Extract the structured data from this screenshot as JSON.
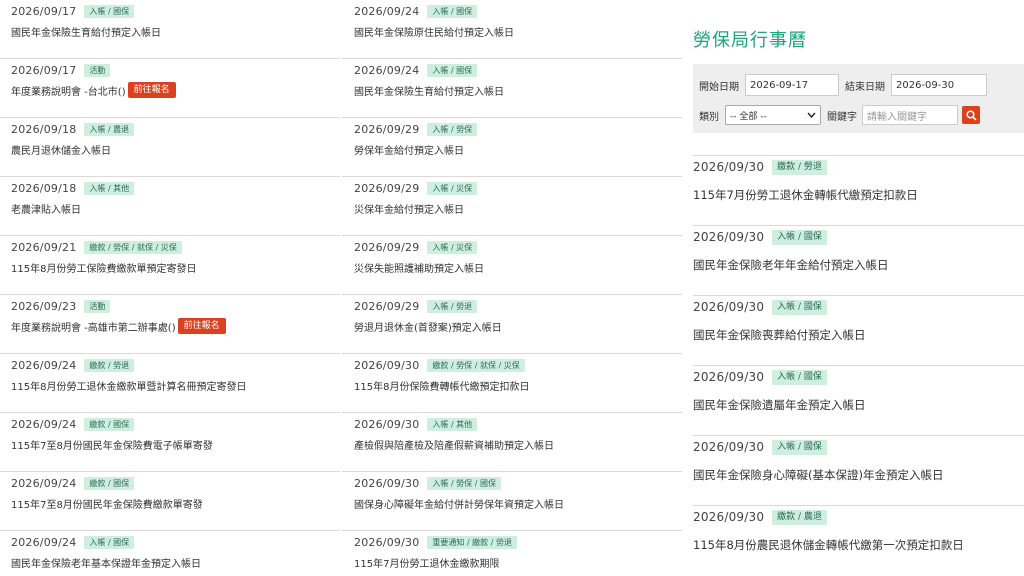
{
  "register_label": "前往報名",
  "column1": [
    {
      "date": "2026/09/17",
      "tag": "入帳 / 國保",
      "title": "國民年金保險生育給付預定入帳日"
    },
    {
      "date": "2026/09/17",
      "tag": "活動",
      "title": "年度業務說明會 -台北市()",
      "register": true
    },
    {
      "date": "2026/09/18",
      "tag": "入帳 / 農退",
      "title": "農民月退休儲金入帳日"
    },
    {
      "date": "2026/09/18",
      "tag": "入帳 / 其他",
      "title": "老農津貼入帳日"
    },
    {
      "date": "2026/09/21",
      "tag": "繳款 / 勞保 / 就保 / 災保",
      "title": "115年8月份勞工保險費繳款單預定寄發日"
    },
    {
      "date": "2026/09/23",
      "tag": "活動",
      "title": "年度業務說明會 -高雄市第二辦事處()",
      "register": true
    },
    {
      "date": "2026/09/24",
      "tag": "繳款 / 勞退",
      "title": "115年8月份勞工退休金繳款單暨計算名冊預定寄發日"
    },
    {
      "date": "2026/09/24",
      "tag": "繳款 / 國保",
      "title": "115年7至8月份國民年金保險費電子帳單寄發"
    },
    {
      "date": "2026/09/24",
      "tag": "繳款 / 國保",
      "title": "115年7至8月份國民年金保險費繳款單寄發"
    },
    {
      "date": "2026/09/24",
      "tag": "入帳 / 國保",
      "title": "國民年金保險老年基本保證年金預定入帳日"
    }
  ],
  "column2": [
    {
      "date": "2026/09/24",
      "tag": "入帳 / 國保",
      "title": "國民年金保險原住民給付預定入帳日"
    },
    {
      "date": "2026/09/24",
      "tag": "入帳 / 國保",
      "title": "國民年金保險生育給付預定入帳日"
    },
    {
      "date": "2026/09/29",
      "tag": "入帳 / 勞保",
      "title": "勞保年金給付預定入帳日"
    },
    {
      "date": "2026/09/29",
      "tag": "入帳 / 災保",
      "title": "災保年金給付預定入帳日"
    },
    {
      "date": "2026/09/29",
      "tag": "入帳 / 災保",
      "title": "災保失能照護補助預定入帳日"
    },
    {
      "date": "2026/09/29",
      "tag": "入帳 / 勞退",
      "title": "勞退月退休金(首發案)預定入帳日"
    },
    {
      "date": "2026/09/30",
      "tag": "繳款 / 勞保 / 就保 / 災保",
      "title": "115年8月份保險費轉帳代繳預定扣款日"
    },
    {
      "date": "2026/09/30",
      "tag": "入帳 / 其他",
      "title": "產檢假與陪產檢及陪產假薪資補助預定入帳日"
    },
    {
      "date": "2026/09/30",
      "tag": "入帳 / 勞保 / 國保",
      "title": "國保身心障礙年金給付併計勞保年資預定入帳日"
    },
    {
      "date": "2026/09/30",
      "tag": "重要通知 / 繳款 / 勞退",
      "title": "115年7月份勞工退休金繳款期限"
    }
  ],
  "calendar": {
    "title": "勞保局行事曆",
    "start_label": "開始日期",
    "start_value": "2026-09-17",
    "end_label": "結束日期",
    "end_value": "2026-09-30",
    "category_label": "類別",
    "category_value": "-- 全部 --",
    "keyword_label": "關鍵字",
    "keyword_placeholder": "請輸入關鍵字",
    "accent": "#1aa57a",
    "button_color": "#d9411f"
  },
  "column3": [
    {
      "date": "2026/09/30",
      "tag": "繳款 / 勞退",
      "title": "115年7月份勞工退休金轉帳代繳預定扣款日"
    },
    {
      "date": "2026/09/30",
      "tag": "入帳 / 國保",
      "title": "國民年金保險老年年金給付預定入帳日"
    },
    {
      "date": "2026/09/30",
      "tag": "入帳 / 國保",
      "title": "國民年金保險喪葬給付預定入帳日"
    },
    {
      "date": "2026/09/30",
      "tag": "入帳 / 國保",
      "title": "國民年金保險遺屬年金預定入帳日"
    },
    {
      "date": "2026/09/30",
      "tag": "入帳 / 國保",
      "title": "國民年金保險身心障礙(基本保證)年金預定入帳日"
    },
    {
      "date": "2026/09/30",
      "tag": "繳款 / 農退",
      "title": "115年8月份農民退休儲金轉帳代繳第一次預定扣款日"
    }
  ]
}
